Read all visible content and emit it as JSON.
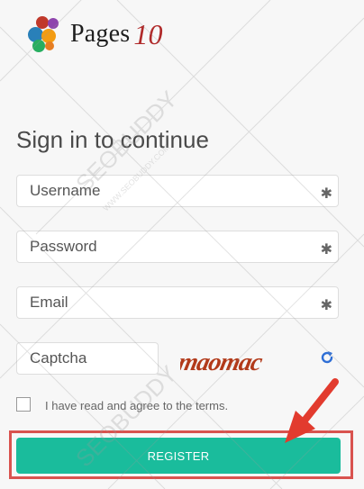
{
  "brand": {
    "name": "Pages",
    "version": "10"
  },
  "form": {
    "title": "Sign in to continue",
    "fields": [
      {
        "placeholder": "Username",
        "required_mark": "✱"
      },
      {
        "placeholder": "Password",
        "required_mark": "✱"
      },
      {
        "placeholder": "Email",
        "required_mark": "✱"
      }
    ],
    "captcha": {
      "placeholder": "Captcha",
      "image_text": "maomac"
    },
    "terms_label": "I have read and agree to the terms.",
    "submit_label": "REGISTER"
  },
  "watermark": {
    "text": "SEOBUDDY",
    "url": "WWW.SEOBUDDY.COM"
  },
  "colors": {
    "accent": "#1abc9c",
    "highlight": "#d9534f",
    "brand_number": "#b02a2a"
  }
}
